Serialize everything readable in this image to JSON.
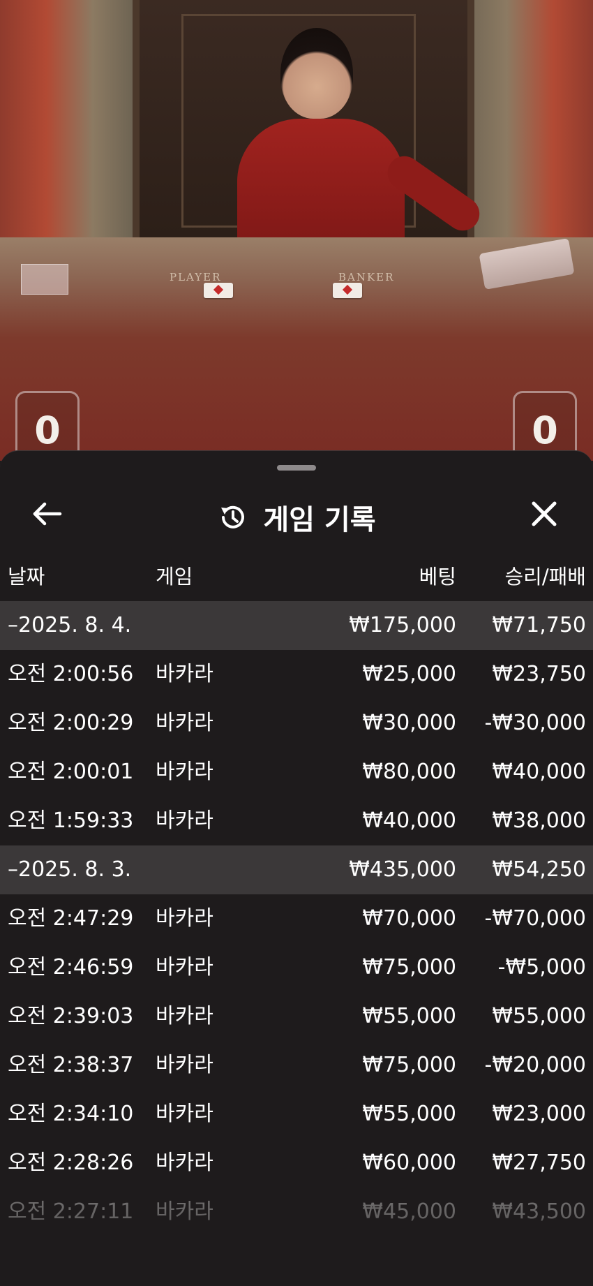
{
  "video": {
    "table_labels": {
      "player": "PLAYER",
      "banker": "BANKER"
    },
    "player_score": "0",
    "banker_score": "0"
  },
  "sheet": {
    "title": "게임 기록",
    "icons": {
      "back": "arrow-left-icon",
      "history": "history-icon",
      "close": "close-icon"
    }
  },
  "columns": {
    "date": "날짜",
    "game": "게임",
    "bet": "베팅",
    "result": "승리/패배"
  },
  "groups": [
    {
      "date": "–2025. 8. 4.",
      "total_bet": "₩175,000",
      "total_result": "₩71,750",
      "rows": [
        {
          "time": "오전 2:00:56",
          "game": "바카라",
          "bet": "₩25,000",
          "result": "₩23,750"
        },
        {
          "time": "오전 2:00:29",
          "game": "바카라",
          "bet": "₩30,000",
          "result": "-₩30,000"
        },
        {
          "time": "오전 2:00:01",
          "game": "바카라",
          "bet": "₩80,000",
          "result": "₩40,000"
        },
        {
          "time": "오전 1:59:33",
          "game": "바카라",
          "bet": "₩40,000",
          "result": "₩38,000"
        }
      ]
    },
    {
      "date": "–2025. 8. 3.",
      "total_bet": "₩435,000",
      "total_result": "₩54,250",
      "rows": [
        {
          "time": "오전 2:47:29",
          "game": "바카라",
          "bet": "₩70,000",
          "result": "-₩70,000"
        },
        {
          "time": "오전 2:46:59",
          "game": "바카라",
          "bet": "₩75,000",
          "result": "-₩5,000"
        },
        {
          "time": "오전 2:39:03",
          "game": "바카라",
          "bet": "₩55,000",
          "result": "₩55,000"
        },
        {
          "time": "오전 2:38:37",
          "game": "바카라",
          "bet": "₩75,000",
          "result": "-₩20,000"
        },
        {
          "time": "오전 2:34:10",
          "game": "바카라",
          "bet": "₩55,000",
          "result": "₩23,000"
        },
        {
          "time": "오전 2:28:26",
          "game": "바카라",
          "bet": "₩60,000",
          "result": "₩27,750"
        },
        {
          "time": "오전 2:27:11",
          "game": "바카라",
          "bet": "₩45,000",
          "result": "₩43,500"
        }
      ]
    }
  ]
}
